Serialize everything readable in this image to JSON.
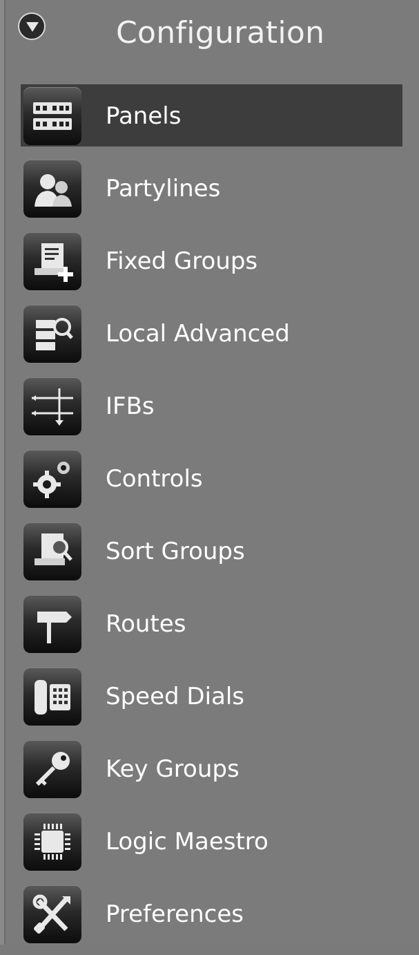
{
  "header": {
    "title": "Configuration",
    "collapse_icon": "chevron-down-icon"
  },
  "menu": {
    "selected": "Panels",
    "items": [
      {
        "label": "Panels",
        "icon": "panels-icon"
      },
      {
        "label": "Partylines",
        "icon": "users-icon"
      },
      {
        "label": "Fixed Groups",
        "icon": "fixed-groups-icon"
      },
      {
        "label": "Local Advanced",
        "icon": "local-advanced-icon"
      },
      {
        "label": "IFBs",
        "icon": "ifb-icon"
      },
      {
        "label": "Controls",
        "icon": "gears-icon"
      },
      {
        "label": "Sort Groups",
        "icon": "sort-groups-icon"
      },
      {
        "label": "Routes",
        "icon": "signpost-icon"
      },
      {
        "label": "Speed Dials",
        "icon": "phone-icon"
      },
      {
        "label": "Key Groups",
        "icon": "key-icon"
      },
      {
        "label": "Logic Maestro",
        "icon": "chip-icon"
      },
      {
        "label": "Preferences",
        "icon": "tools-icon"
      }
    ]
  },
  "colors": {
    "background": "#7b7b7b",
    "selected_background": "#3d3d3d",
    "text": "#ffffff"
  }
}
